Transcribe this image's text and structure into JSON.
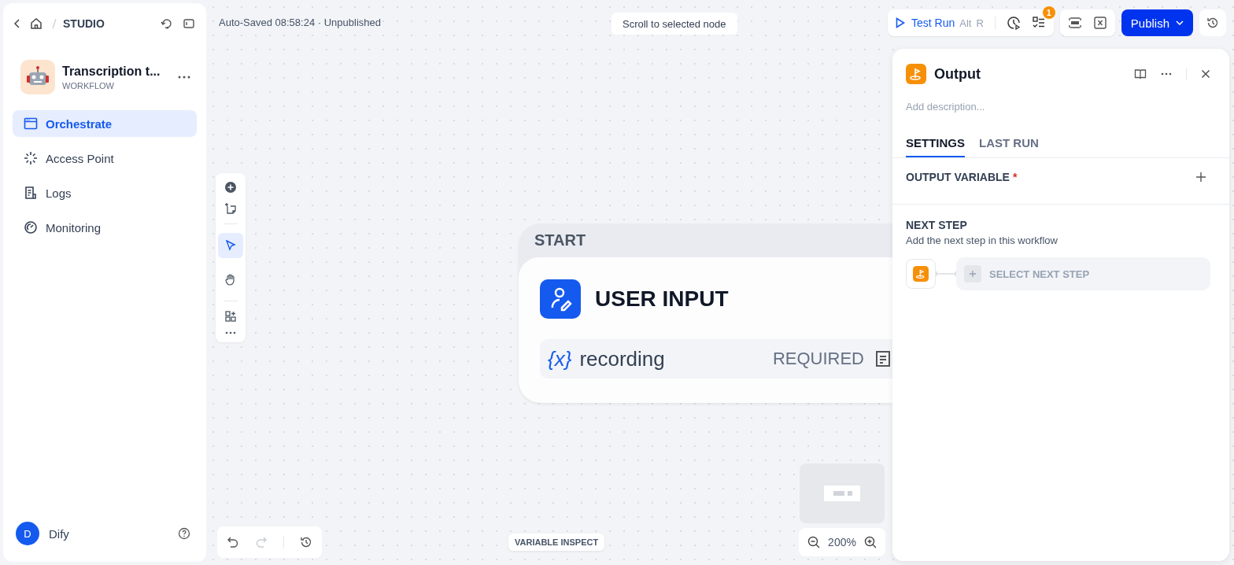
{
  "breadcrumb": {
    "label": "STUDIO"
  },
  "app": {
    "name": "Transcription t...",
    "type": "WORKFLOW"
  },
  "nav": [
    {
      "kind": "orchestrate",
      "label": "Orchestrate",
      "selected": true
    },
    {
      "kind": "access",
      "label": "Access Point",
      "selected": false
    },
    {
      "kind": "logs",
      "label": "Logs",
      "selected": false
    },
    {
      "kind": "monitoring",
      "label": "Monitoring",
      "selected": false
    }
  ],
  "user": {
    "initial": "D",
    "name": "Dify"
  },
  "status": "Auto-Saved 08:58:24 · Unpublished",
  "scroll_hint": "Scroll to selected node",
  "test_run": {
    "label": "Test Run",
    "keys": [
      "Alt",
      "R"
    ]
  },
  "checklist_badge": "1",
  "publish": "Publish",
  "tools": [
    {
      "kind": "pointer",
      "selected": true
    },
    {
      "kind": "hand",
      "selected": false
    }
  ],
  "node": {
    "header": "START",
    "title": "USER INPUT",
    "variable": {
      "symbol": "{x}",
      "name": "recording",
      "tag": "REQUIRED"
    }
  },
  "variable_inspect": "VARIABLE INSPECT",
  "zoom": "200%",
  "panel": {
    "title": "Output",
    "description_placeholder": "Add description...",
    "tabs": [
      {
        "label": "SETTINGS",
        "selected": true
      },
      {
        "label": "LAST RUN",
        "selected": false
      }
    ],
    "output_variable": {
      "label": "OUTPUT VARIABLE",
      "required": true,
      "required_mark": "*"
    },
    "next_step": {
      "title": "NEXT STEP",
      "hint": "Add the next step in this workflow",
      "button": "SELECT NEXT STEP"
    }
  }
}
